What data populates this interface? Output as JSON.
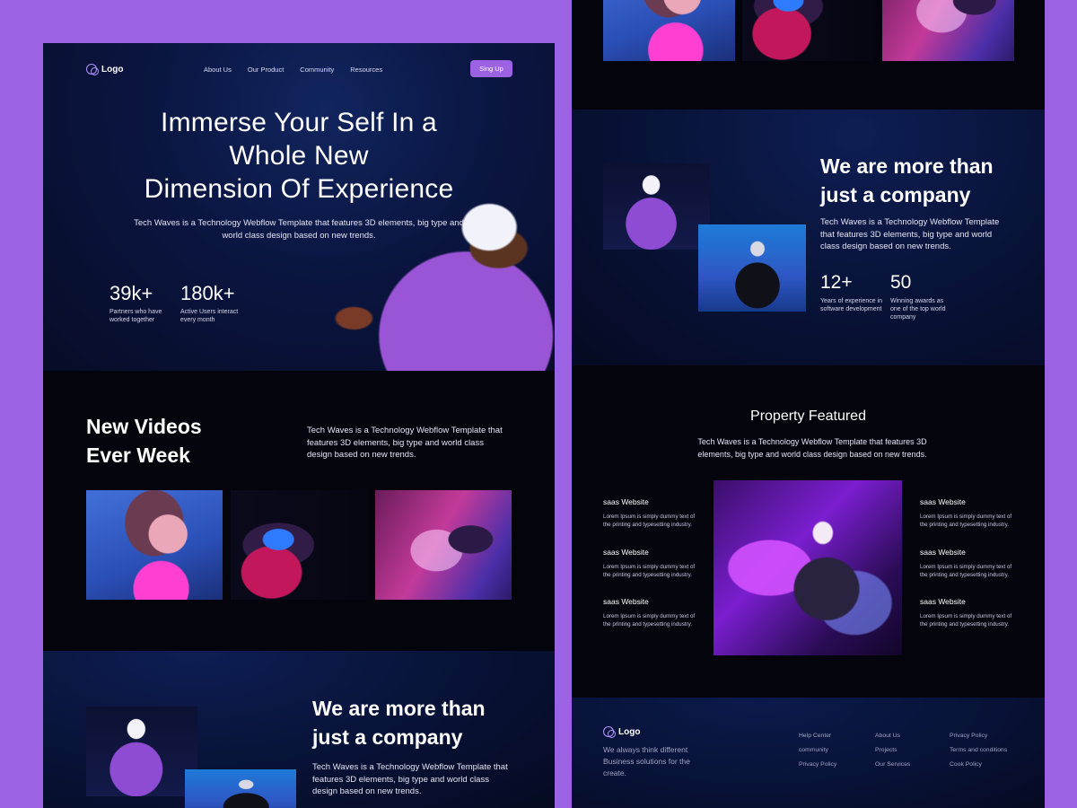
{
  "nav": {
    "logo_label": "Logo",
    "links": [
      "About Us",
      "Our Product",
      "Community",
      "Resources"
    ],
    "cta_label": "Sing Up"
  },
  "hero": {
    "title_lines": [
      "Immerse Your Self In a",
      "Whole New",
      "Dimension Of Experience"
    ],
    "subtitle": "Tech Waves is a Technology Webflow Template that features 3D elements, big type and world class design based on new trends.",
    "stats": [
      {
        "value": "39k+",
        "label": "Partners who have worked together"
      },
      {
        "value": "180k+",
        "label": "Active Users interact every month"
      }
    ]
  },
  "videos": {
    "title_lines": [
      "New Videos",
      "Ever Week"
    ],
    "text": "Tech Waves is a Technology Webflow Template that features 3D elements, big type and world class design based on new trends."
  },
  "company": {
    "title_lines": [
      "We are more than",
      "just a company"
    ],
    "text": "Tech Waves is a Technology Webflow Template that features 3D elements, big type and world class design based on new trends.",
    "stats": [
      {
        "value": "12+",
        "label": "Years of experience in software development"
      },
      {
        "value": "50",
        "label": "Winning awards as one of the top world company"
      }
    ]
  },
  "featured": {
    "title": "Property Featured",
    "text": "Tech Waves is a Technology Webflow Template that features 3D elements, big type and world class design based on new trends.",
    "item_title": "saas Website",
    "item_desc": "Lorem Ipsum is simply dummy text of the printing and typesetting industry."
  },
  "footer": {
    "logo_label": "Logo",
    "tagline": "We always think different Business solutions for the create.",
    "col1": [
      "Help Center",
      "community",
      "Privacy Policy"
    ],
    "col2": [
      "About Us",
      "Projects",
      "Our Services"
    ],
    "col3": [
      "Privacy Policy",
      "Terms and conditions",
      "Cook Policy"
    ]
  },
  "colors": {
    "page_bg": "#9b63e3",
    "accent": "#9b63e3",
    "dark_bg": "#03040c",
    "navy_bg": "#0a1540"
  }
}
